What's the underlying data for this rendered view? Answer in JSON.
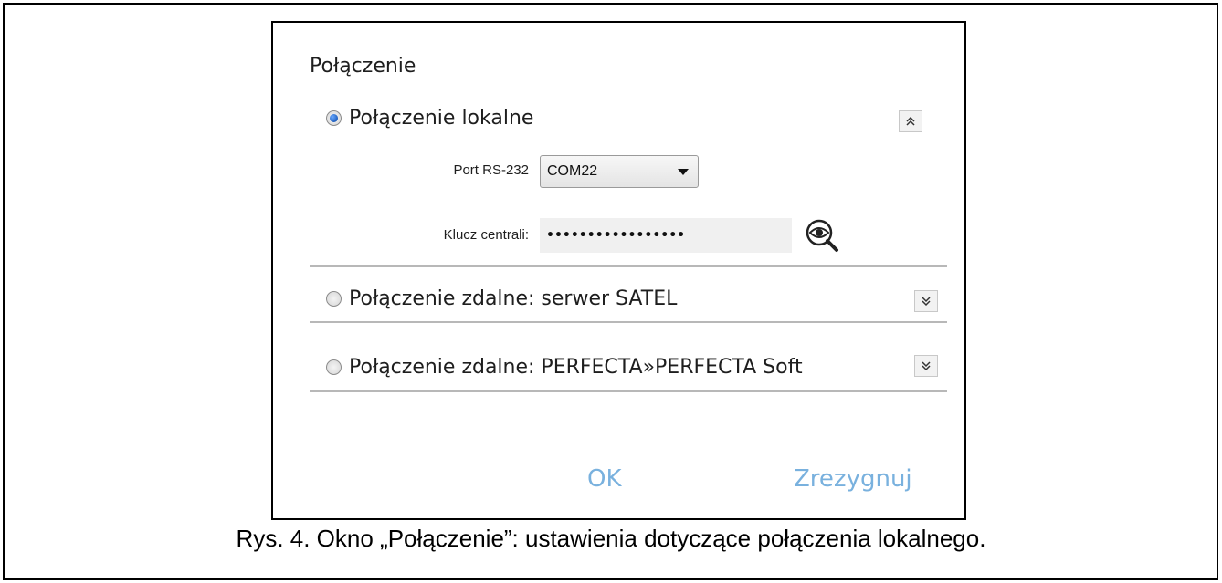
{
  "dialog": {
    "title": "Połączenie",
    "local": {
      "label": "Połączenie lokalne",
      "selected": true,
      "port_label": "Port RS-232",
      "port_value": "COM22",
      "key_label": "Klucz centrali:",
      "key_value": "•••••••••••••••••"
    },
    "remote_satel": {
      "label": "Połączenie zdalne: serwer SATEL",
      "selected": false
    },
    "remote_perfecta": {
      "label": "Połączenie zdalne: PERFECTA»PERFECTA Soft",
      "selected": false
    },
    "ok_label": "OK",
    "cancel_label": "Zrezygnuj"
  },
  "caption": "Rys. 4. Okno „Połączenie”: ustawienia dotyczące połączenia lokalnego.",
  "colors": {
    "button_text": "#79b1de",
    "radio_selected": "#1f5fbf"
  },
  "icons": {
    "collapse": "double-chevron-up-icon",
    "expand": "double-chevron-down-icon",
    "reveal": "eye-magnifier-icon"
  }
}
